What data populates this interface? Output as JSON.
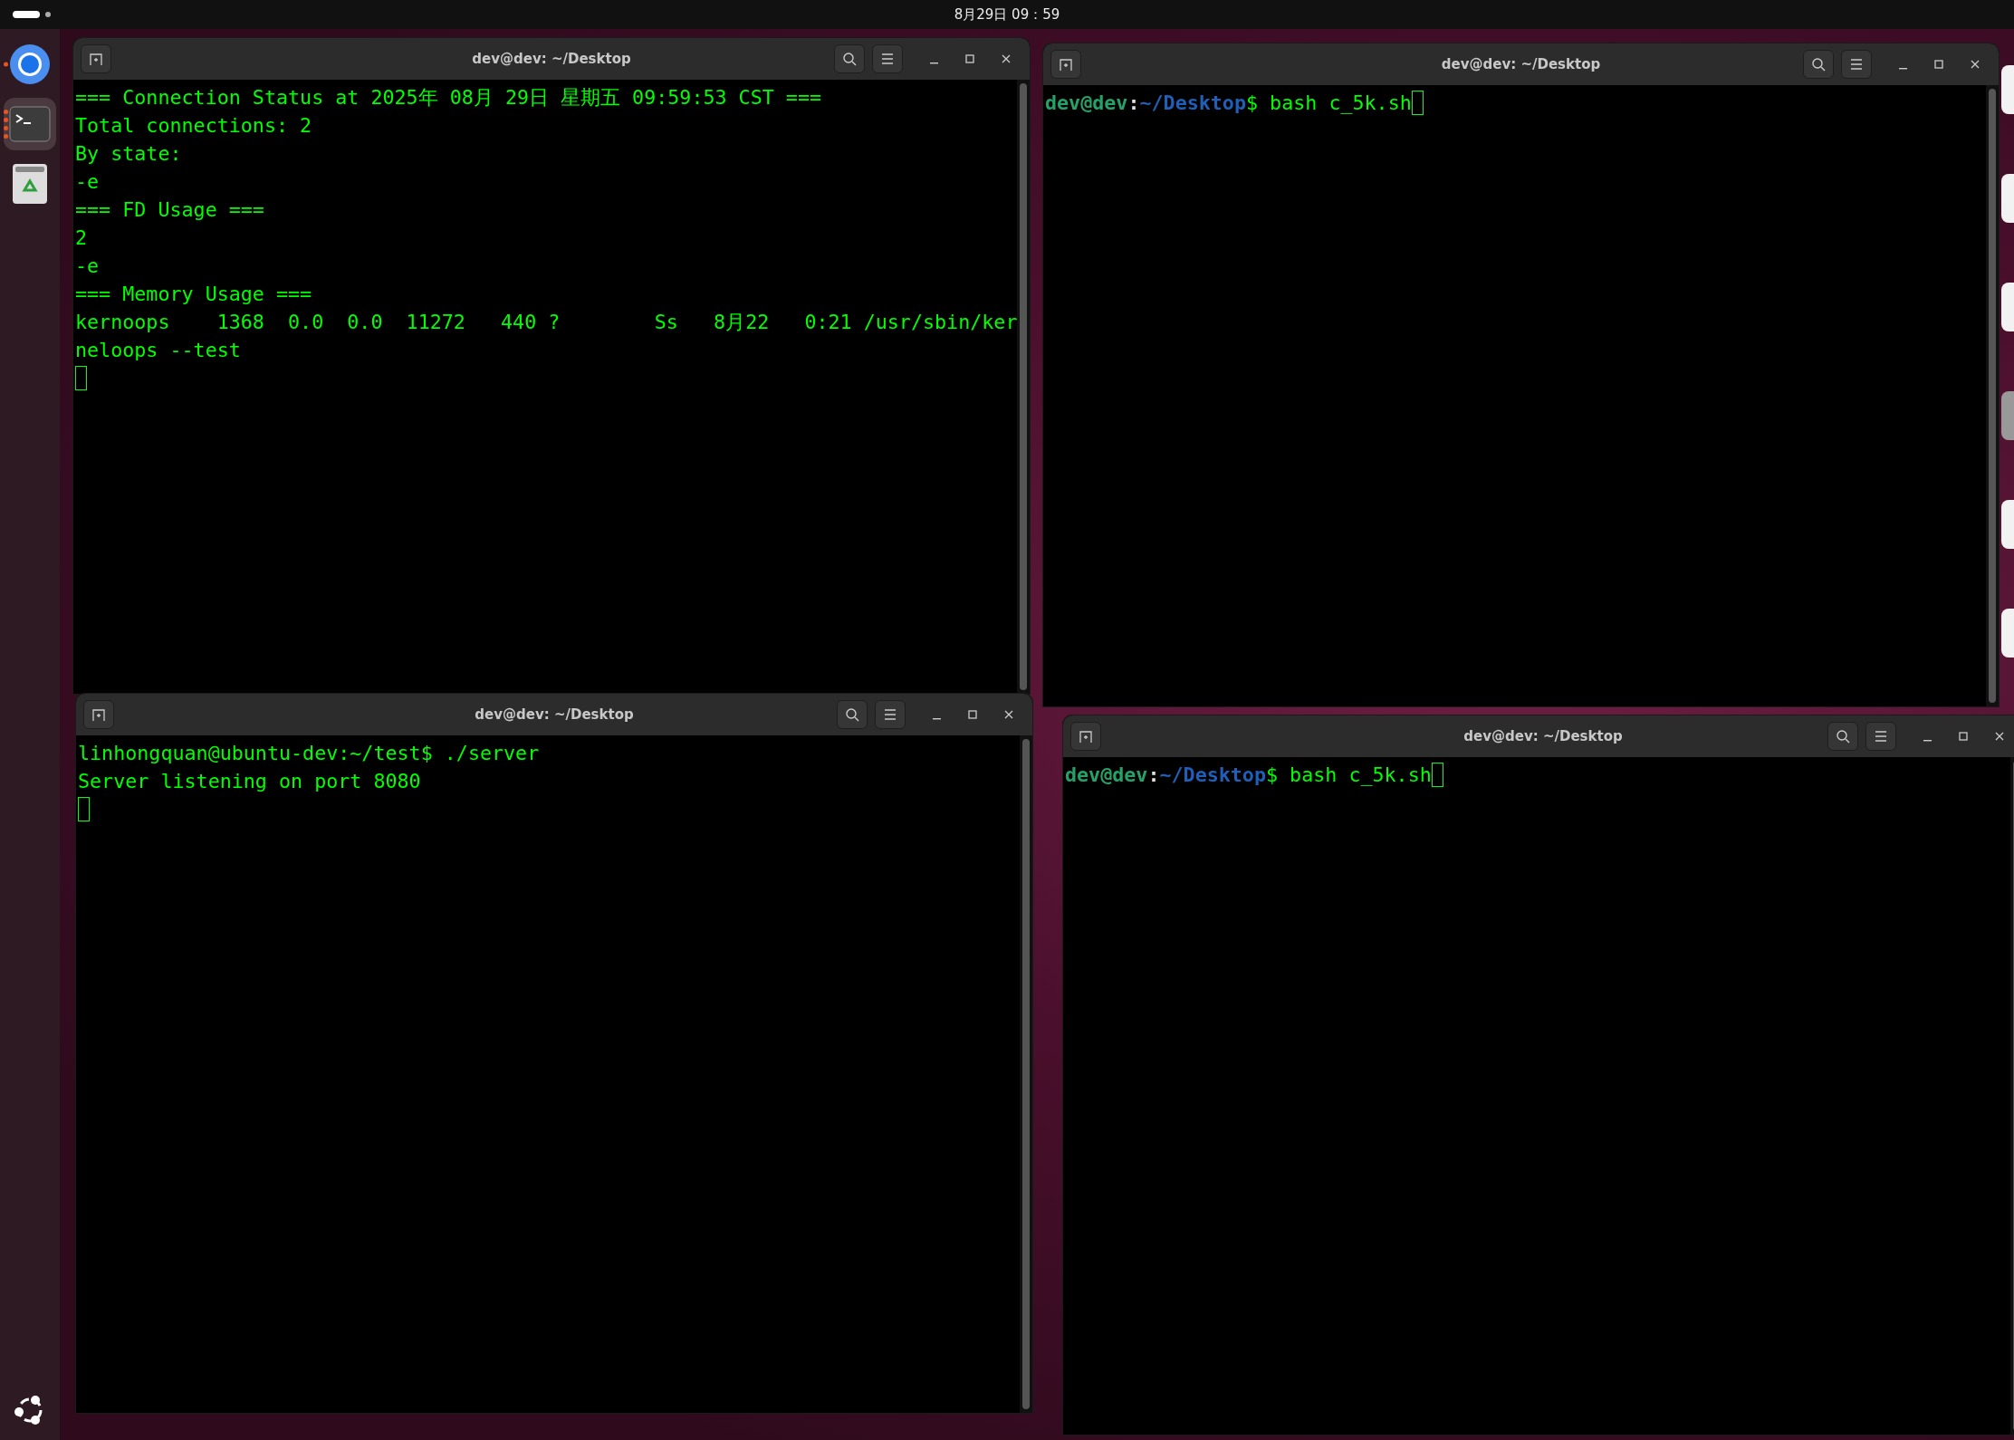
{
  "top_bar": {
    "clock": "8月29日  09：59"
  },
  "dock": {
    "items": [
      {
        "kind": "browser",
        "running": true,
        "multiple_windows": false,
        "selected": false
      },
      {
        "kind": "terminal",
        "running": true,
        "multiple_windows": true,
        "selected": true
      },
      {
        "kind": "trash",
        "running": false,
        "selected": false
      }
    ]
  },
  "windows": [
    {
      "title": "dev@dev: ~/Desktop",
      "lines": [
        {
          "kind": "output",
          "text": "=== Connection Status at 2025年 08月 29日 星期五 09:59:53 CST ==="
        },
        {
          "kind": "output",
          "text": "Total connections: 2"
        },
        {
          "kind": "output",
          "text": "By state:"
        },
        {
          "kind": "output",
          "text": "-e"
        },
        {
          "kind": "output",
          "text": "=== FD Usage ==="
        },
        {
          "kind": "output",
          "text": "2"
        },
        {
          "kind": "output",
          "text": "-e"
        },
        {
          "kind": "output",
          "text": "=== Memory Usage ==="
        },
        {
          "kind": "output",
          "text": "kernoops    1368  0.0  0.0  11272   440 ?        Ss   8月22   0:21 /usr/sbin/ker"
        },
        {
          "kind": "output",
          "text": "neloops --test"
        },
        {
          "kind": "cursor"
        }
      ]
    },
    {
      "title": "dev@dev: ~/Desktop",
      "lines": [
        {
          "kind": "prompt",
          "user_host": "dev@dev",
          "separator": ":",
          "path": "~/Desktop",
          "command": "$ bash c_5k.sh",
          "cursor": true
        }
      ]
    },
    {
      "title": "dev@dev: ~/Desktop",
      "lines": [
        {
          "kind": "output",
          "text": "linhongquan@ubuntu-dev:~/test$ ./server"
        },
        {
          "kind": "output",
          "text": "Server listening on port 8080"
        },
        {
          "kind": "cursor"
        }
      ]
    },
    {
      "title": "dev@dev: ~/Desktop",
      "lines": [
        {
          "kind": "prompt",
          "user_host": "dev@dev",
          "separator": ":",
          "path": "~/Desktop",
          "command": "$ bash c_5k.sh",
          "cursor": true
        }
      ]
    }
  ]
}
